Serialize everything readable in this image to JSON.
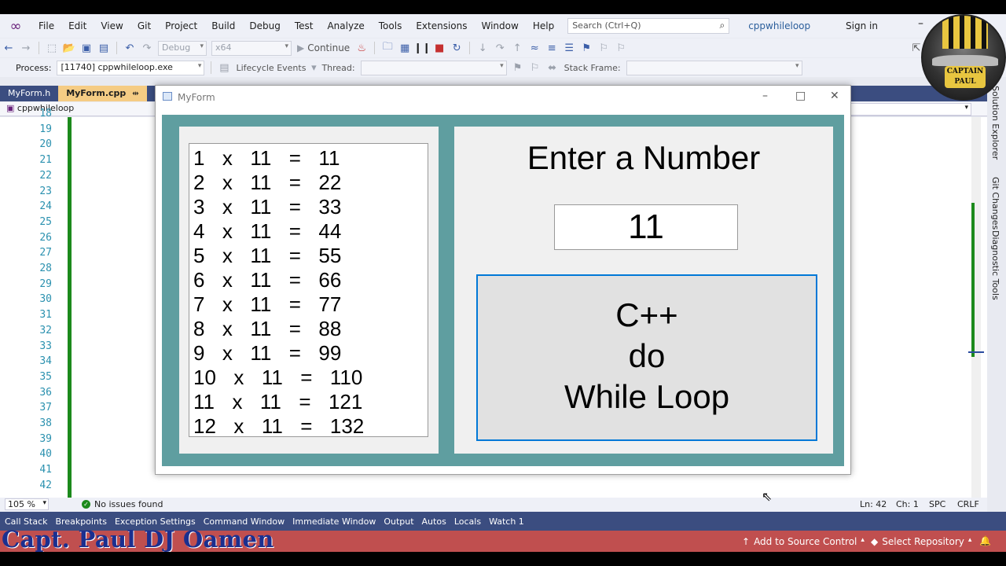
{
  "menu": [
    "File",
    "Edit",
    "View",
    "Git",
    "Project",
    "Build",
    "Debug",
    "Test",
    "Analyze",
    "Tools",
    "Extensions",
    "Window",
    "Help"
  ],
  "search": {
    "placeholder": "Search (Ctrl+Q)"
  },
  "solution_name": "cppwhileloop",
  "sign_in": "Sign in",
  "toolbar": {
    "config": "Debug",
    "platform": "x64",
    "continue_label": "Continue",
    "process_label": "Process:",
    "process_value": "[11740] cppwhileloop.exe",
    "lifecycle_label": "Lifecycle Events",
    "thread_label": "Thread:",
    "stack_frame_label": "Stack Frame:"
  },
  "doc_tabs": [
    "MyForm.h",
    "MyForm.cpp"
  ],
  "active_tab_pin": "⇹",
  "nav": {
    "project": "cppwhileloop"
  },
  "editor": {
    "line_numbers": [
      "18",
      "19",
      "20",
      "21",
      "22",
      "23",
      "24",
      "25",
      "26",
      "27",
      "28",
      "29",
      "30",
      "31",
      "32",
      "33",
      "34",
      "35",
      "36",
      "37",
      "38",
      "39",
      "40",
      "41",
      "42"
    ]
  },
  "right_rail": [
    "Solution Explorer",
    "Git Changes",
    "Diagnostic Tools"
  ],
  "editor_status": {
    "zoom": "105 %",
    "issues": "No issues found",
    "ln": "Ln: 42",
    "ch": "Ch: 1",
    "spc": "SPC",
    "crlf": "CRLF"
  },
  "tool_tabs": [
    "Call Stack",
    "Breakpoints",
    "Exception Settings",
    "Command Window",
    "Immediate Window",
    "Output",
    "Autos",
    "Locals",
    "Watch 1"
  ],
  "statusbar": {
    "watermark": "Capt. Paul DJ Oamen",
    "source_control": "Add to Source Control",
    "select_repo": "Select Repository"
  },
  "logo": {
    "text_line1": "CAPTAIN",
    "text_line2": "PAUL"
  },
  "myform": {
    "title": "MyForm",
    "table_lines": [
      "1  x  11  =  11",
      "2  x  11  =  22",
      "3  x  11  =  33",
      "4  x  11  =  44",
      "5  x  11  =  55",
      "6  x  11  =  66",
      "7  x  11  =  77",
      "8  x  11  =  88",
      "9  x  11  =  99",
      "10  x  11  =  110",
      "11  x  11  =  121",
      "12  x  11  =  132"
    ],
    "enter_label": "Enter a Number",
    "input_value": "11",
    "button_lines": [
      "C++",
      "do",
      "While Loop"
    ]
  },
  "colors": {
    "form_bg": "#5f9ea0",
    "status_bar": "#c04f4f",
    "tab_active": "#f5cc84",
    "button_border": "#0078d7"
  }
}
